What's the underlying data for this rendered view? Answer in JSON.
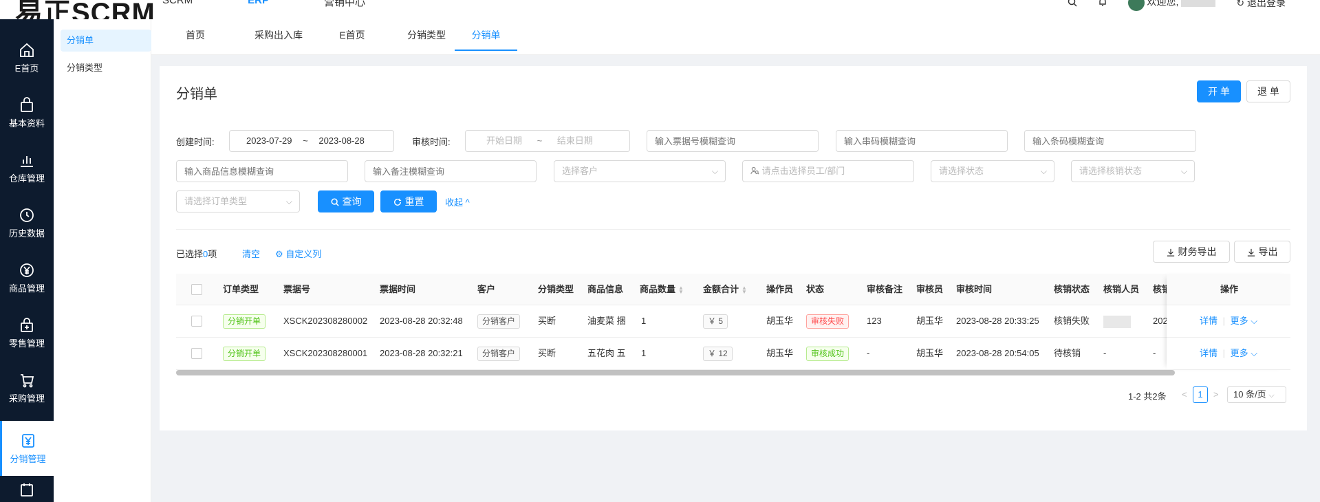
{
  "header": {
    "logo": "易正SCRM",
    "nav": [
      "SCRM",
      "ERP",
      "营销中心"
    ],
    "greeting": "欢迎您,",
    "logout": "退出登录"
  },
  "sidebar": {
    "items": [
      {
        "label": "E首页",
        "icon": "home-icon"
      },
      {
        "label": "基本资料",
        "icon": "bag-icon"
      },
      {
        "label": "仓库管理",
        "icon": "chart-icon"
      },
      {
        "label": "历史数据",
        "icon": "clock-icon"
      },
      {
        "label": "商品管理",
        "icon": "yen-icon"
      },
      {
        "label": "零售管理",
        "icon": "shop-icon"
      },
      {
        "label": "采购管理",
        "icon": "cart-icon"
      },
      {
        "label": "分销管理",
        "icon": "yen-box-icon"
      }
    ]
  },
  "submenu": [
    "分销单",
    "分销类型"
  ],
  "tabs": [
    "首页",
    "采购出入库",
    "E首页",
    "分销类型",
    "分销单"
  ],
  "page": {
    "title": "分销单",
    "open_btn": "开 单",
    "return_btn": "退 单"
  },
  "filters": {
    "create_label": "创建时间:",
    "create_start": "2023-07-29",
    "range_sep": "~",
    "create_end": "2023-08-28",
    "audit_label": "审核时间:",
    "audit_start_ph": "开始日期",
    "audit_end_ph": "结束日期",
    "ticket_ph": "输入票据号模糊查询",
    "serial_ph": "输入串码模糊查询",
    "barcode_ph": "输入条码模糊查询",
    "goods_ph": "输入商品信息模糊查询",
    "remark_ph": "输入备注模糊查询",
    "customer_ph": "选择客户",
    "staff_ph": "请点击选择员工/部门",
    "status_ph": "请选择状态",
    "verify_ph": "请选择核销状态",
    "ordertype_ph": "请选择订单类型",
    "search_btn": "查询",
    "reset_btn": "重置",
    "collapse": "收起"
  },
  "toolbar": {
    "selected_prefix": "已选择",
    "selected_count": "0",
    "selected_suffix": "项",
    "clear": "清空",
    "custom_cols": "自定义列",
    "finance_export": "财务导出",
    "export": "导出"
  },
  "table": {
    "headers": [
      "订单类型",
      "票据号",
      "票据时间",
      "客户",
      "分销类型",
      "商品信息",
      "商品数量",
      "金额合计",
      "操作员",
      "状态",
      "审核备注",
      "审核员",
      "审核时间",
      "核销状态",
      "核销人员",
      "核销",
      "操作"
    ],
    "rows": [
      {
        "order_type": "分销开单",
        "ticket": "XSCK202308280002",
        "time": "2023-08-28 20:32:48",
        "customer": "分销客户",
        "dist_type": "买断",
        "goods": "油麦菜 捆",
        "qty": "1",
        "amount": "￥ 5",
        "operator": "胡玉华",
        "status": "审核失败",
        "remark": "123",
        "auditor": "胡玉华",
        "audit_time": "2023-08-28 20:33:25",
        "verify_status": "核销失败",
        "verifier": "",
        "verify_extra": "202",
        "detail": "详情",
        "more": "更多"
      },
      {
        "order_type": "分销开单",
        "ticket": "XSCK202308280001",
        "time": "2023-08-28 20:32:21",
        "customer": "分销客户",
        "dist_type": "买断",
        "goods": "五花肉 五",
        "qty": "1",
        "amount": "￥ 12",
        "operator": "胡玉华",
        "status": "审核成功",
        "remark": "-",
        "auditor": "胡玉华",
        "audit_time": "2023-08-28 20:54:05",
        "verify_status": "待核销",
        "verifier": "-",
        "verify_extra": "-",
        "detail": "详情",
        "more": "更多"
      }
    ]
  },
  "pagination": {
    "summary": "1-2 共2条",
    "current": "1",
    "page_size": "10 条/页"
  },
  "colors": {
    "primary": "#1890ff",
    "sidebar": "#0d1b2e",
    "success": "#52c41a",
    "danger": "#ff4d4f"
  }
}
